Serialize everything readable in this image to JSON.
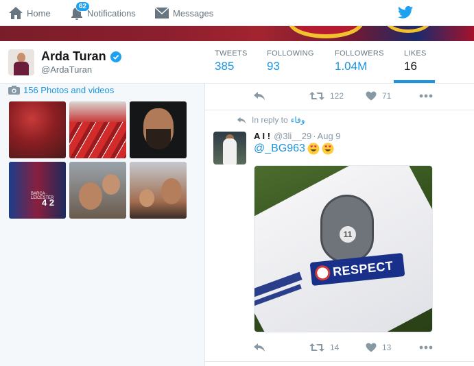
{
  "nav": {
    "home_label": "Home",
    "notifications_label": "Notifications",
    "notifications_count": "62",
    "messages_label": "Messages"
  },
  "profile": {
    "name": "Arda Turan",
    "handle": "@ArdaTuran",
    "verified": true
  },
  "stats": {
    "tweets_label": "TWEETS",
    "tweets_value": "385",
    "following_label": "FOLLOWING",
    "following_value": "93",
    "followers_label": "FOLLOWERS",
    "followers_value": "1.04M",
    "likes_label": "LIKES",
    "likes_value": "16",
    "active_tab": "likes"
  },
  "sidebar": {
    "photos_label": "156 Photos and videos",
    "thumb_texts": {
      "score_names": "BARCA · LEICESTER",
      "score": "4  2"
    }
  },
  "timeline": {
    "top_actions": {
      "retweets": "122",
      "likes": "71"
    },
    "tweet": {
      "reply_label": "In reply to",
      "reply_name": "وفاء",
      "name": "A I !",
      "handle": "@3li__29",
      "dot": "·",
      "date": "Aug 9",
      "mention": "@_BG963",
      "media_badge_number": "11",
      "media_patch_text": "RESPECT",
      "actions": {
        "retweets": "14",
        "likes": "13"
      }
    }
  },
  "colors": {
    "accent": "#1b95e0",
    "muted": "#8899a6",
    "background": "#f5f8fa"
  }
}
